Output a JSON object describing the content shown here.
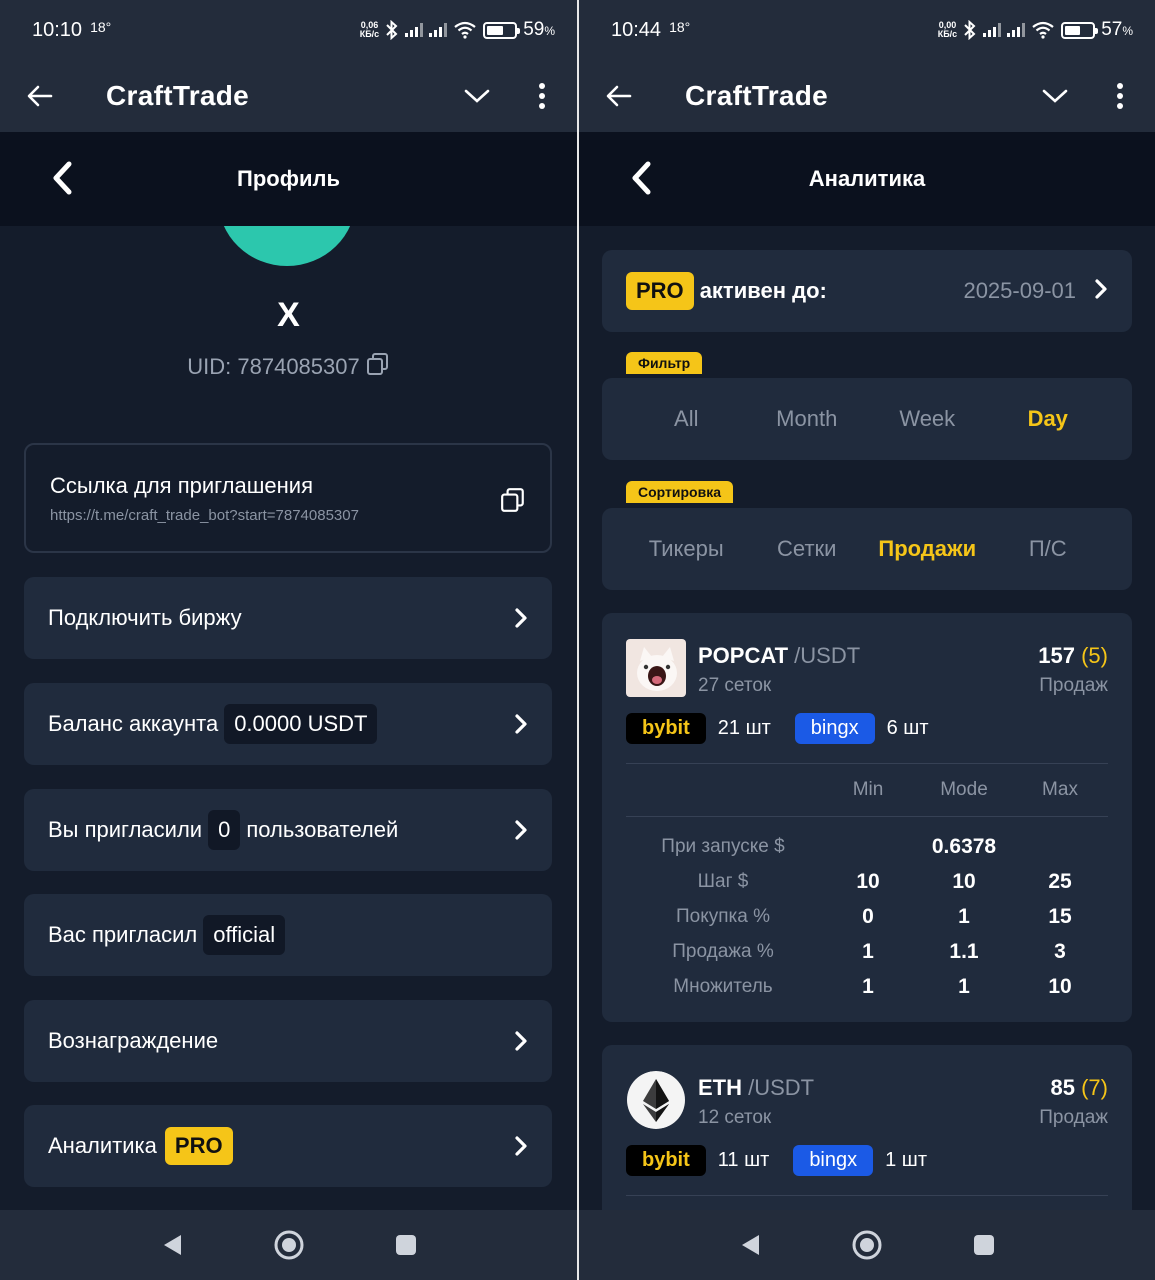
{
  "left": {
    "status": {
      "time": "10:10",
      "temp": "18°",
      "net_speed_top": "0,06",
      "net_speed_bottom": "КБ/с",
      "battery": "59",
      "battery_unit": "%",
      "battery_level": 0.59
    },
    "app_title": "CraftTrade",
    "nav_title": "Профиль",
    "profile": {
      "name": "X",
      "uid_label": "UID: 7874085307"
    },
    "invite": {
      "title": "Ссылка для приглашения",
      "link": "https://t.me/craft_trade_bot?start=7874085307"
    },
    "menu": {
      "connect_exchange": "Подключить биржу",
      "balance_label": "Баланс аккаунта",
      "balance_value": "0.0000 USDT",
      "invited_prefix": "Вы пригласили",
      "invited_count": "0",
      "invited_suffix": "пользователей",
      "inviter_label": "Вас пригласил",
      "inviter_value": "official",
      "reward": "Вознаграждение",
      "analytics": "Аналитика",
      "pro": "PRO"
    }
  },
  "right": {
    "status": {
      "time": "10:44",
      "temp": "18°",
      "net_speed_top": "0,00",
      "net_speed_bottom": "КБ/с",
      "battery": "57",
      "battery_unit": "%",
      "battery_level": 0.57
    },
    "app_title": "CraftTrade",
    "nav_title": "Аналитика",
    "pro_card": {
      "badge": "PRO",
      "label": "активен до:",
      "date": "2025-09-01"
    },
    "filter": {
      "tag": "Фильтр",
      "options": [
        "All",
        "Month",
        "Week",
        "Day"
      ],
      "active": "Day"
    },
    "sort": {
      "tag": "Сортировка",
      "options": [
        "Тикеры",
        "Сетки",
        "Продажи",
        "П/С"
      ],
      "active": "Продажи"
    },
    "coins": [
      {
        "symbol": "POPCAT",
        "quote": "/USDT",
        "grids": "27 сеток",
        "sales": "157",
        "sales_recent": "(5)",
        "sales_label": "Продаж",
        "bybit": "bybit",
        "bybit_count": "21 шт",
        "bingx": "bingx",
        "bingx_count": "6 шт",
        "columns": [
          "Min",
          "Mode",
          "Max"
        ],
        "rows": [
          {
            "label": "При запуске $",
            "min": "",
            "mode": "0.6378",
            "max": ""
          },
          {
            "label": "Шаг $",
            "min": "10",
            "mode": "10",
            "max": "25"
          },
          {
            "label": "Покупка %",
            "min": "0",
            "mode": "1",
            "max": "15"
          },
          {
            "label": "Продажа %",
            "min": "1",
            "mode": "1.1",
            "max": "3"
          },
          {
            "label": "Множитель",
            "min": "1",
            "mode": "1",
            "max": "10"
          }
        ]
      },
      {
        "symbol": "ETH",
        "quote": "/USDT",
        "grids": "12 сеток",
        "sales": "85",
        "sales_recent": "(7)",
        "sales_label": "Продаж",
        "bybit": "bybit",
        "bybit_count": "11 шт",
        "bingx": "bingx",
        "bingx_count": "1 шт"
      }
    ]
  }
}
